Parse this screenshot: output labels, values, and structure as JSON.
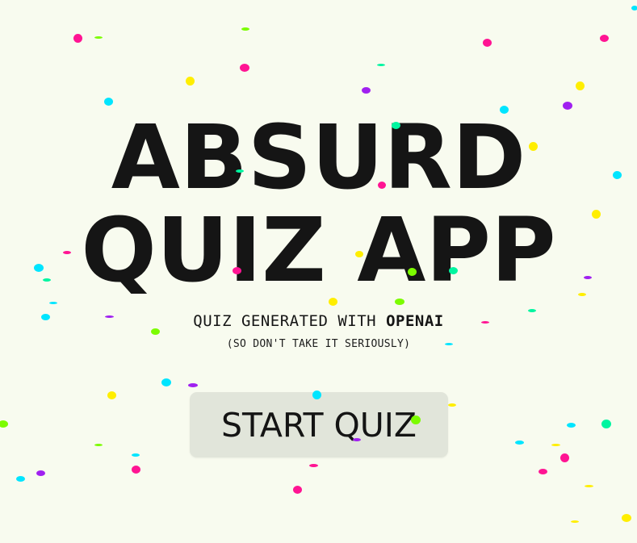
{
  "hero": {
    "title_line_1": "ABSURD",
    "title_line_2": "QUIZ APP",
    "subtitle_prefix": "QUIZ GENERATED WITH ",
    "subtitle_brand": "OPENAI",
    "disclaimer": "(SO DON'T TAKE IT SERIOUSLY)"
  },
  "start_button": {
    "label": "START QUIZ"
  },
  "colors": {
    "background": "#f8fbef",
    "text": "#151515",
    "button_background": "#e1e5da",
    "confetti": [
      "#ff1493",
      "#00e5ff",
      "#ffee00",
      "#7cfc00",
      "#a020f0",
      "#00f5a0"
    ]
  }
}
